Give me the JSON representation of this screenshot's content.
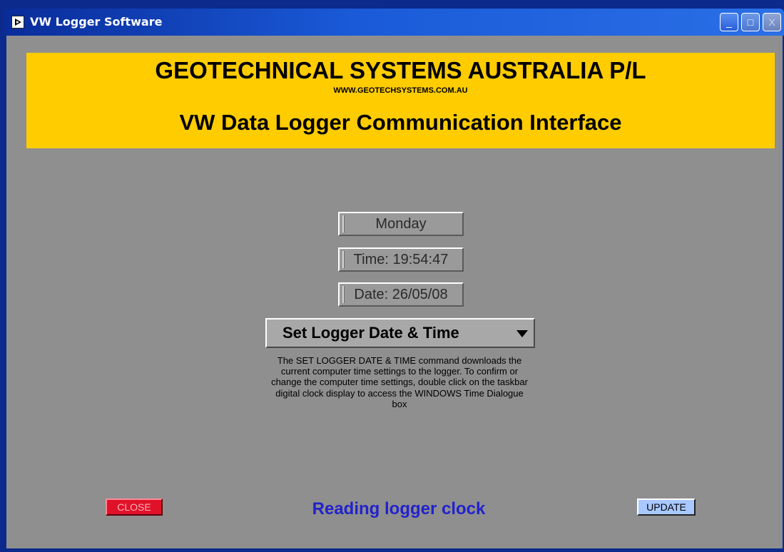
{
  "window": {
    "title": "VW Logger Software",
    "icon": "labview-run-icon"
  },
  "titlebar_buttons": {
    "minimize": "_",
    "maximize": "□",
    "close": "X"
  },
  "banner": {
    "company": "GEOTECHNICAL SYSTEMS AUSTRALIA P/L",
    "url": "WWW.GEOTECHSYSTEMS.COM.AU",
    "subtitle": "VW Data Logger Communication Interface",
    "background_color": "#ffcc00"
  },
  "indicators": {
    "day": "Monday",
    "time": "Time: 19:54:47",
    "date": "Date: 26/05/08"
  },
  "command_ring": {
    "selected": "Set Logger Date & Time"
  },
  "description": "The SET LOGGER DATE & TIME command downloads the current computer time settings to the logger.  To confirm or change the computer time settings, double click on the taskbar digital clock display to access the WINDOWS Time Dialogue box",
  "buttons": {
    "close": "CLOSE",
    "update": "UPDATE"
  },
  "status": "Reading logger clock",
  "colors": {
    "panel": "#8f8f8f",
    "close_button": "#e0122a",
    "update_button": "#a8c8ff",
    "status_text": "#2222cc"
  }
}
